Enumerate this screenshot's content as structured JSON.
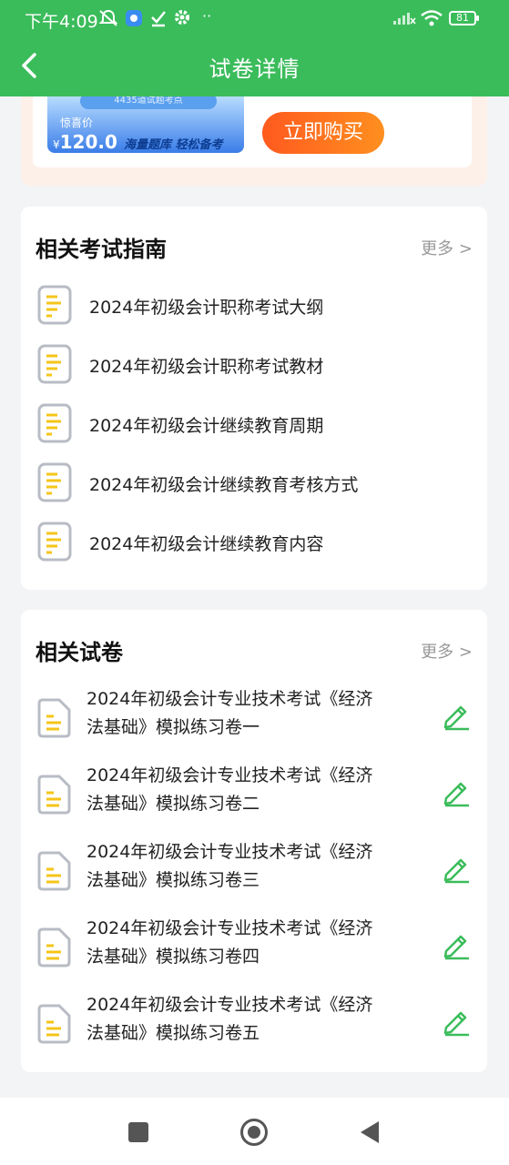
{
  "status": {
    "time": "下午4:09",
    "battery": "81"
  },
  "header": {
    "title": "试卷详情"
  },
  "promo": {
    "banner_pill": "4435道试题考点",
    "banner_tag": "惊喜价",
    "currency": "¥",
    "price": "120.0",
    "slogan": "海量题库 轻松备考",
    "buy_label": "立即购买"
  },
  "guides": {
    "title": "相关考试指南",
    "more": "更多 >",
    "items": [
      {
        "label": "2024年初级会计职称考试大纲"
      },
      {
        "label": "2024年初级会计职称考试教材"
      },
      {
        "label": "2024年初级会计继续教育周期"
      },
      {
        "label": "2024年初级会计继续教育考核方式"
      },
      {
        "label": "2024年初级会计继续教育内容"
      }
    ]
  },
  "papers": {
    "title": "相关试卷",
    "more": "更多 >",
    "items": [
      {
        "line1": "2024年初级会计专业技术考试《经济",
        "line2": "法基础》模拟练习卷一"
      },
      {
        "line1": "2024年初级会计专业技术考试《经济",
        "line2": "法基础》模拟练习卷二"
      },
      {
        "line1": "2024年初级会计专业技术考试《经济",
        "line2": "法基础》模拟练习卷三"
      },
      {
        "line1": "2024年初级会计专业技术考试《经济",
        "line2": "法基础》模拟练习卷四"
      },
      {
        "line1": "2024年初级会计专业技术考试《经济",
        "line2": "法基础》模拟练习卷五"
      }
    ]
  },
  "colors": {
    "brand_green": "#3bbc5b",
    "buy_orange": "#ff6a1f",
    "doc_yellow": "#f5c518",
    "edit_green": "#3bbc5b"
  },
  "icons": {
    "back": "chevron-left-icon",
    "guide_doc": "document-icon",
    "paper_doc": "document-icon",
    "edit": "pencil-icon"
  }
}
